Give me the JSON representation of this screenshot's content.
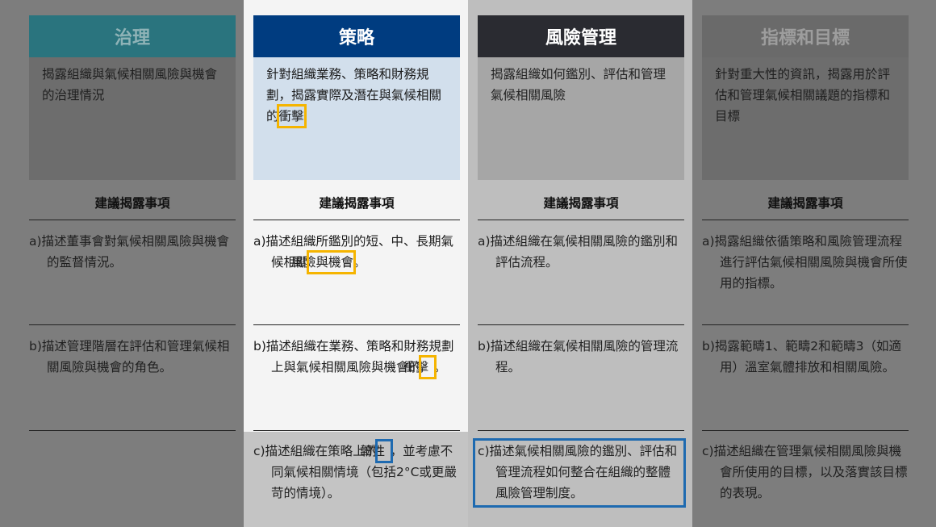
{
  "subheading": "建議揭露事項",
  "columns": [
    {
      "key": "governance",
      "title": "治理",
      "description": "揭露組織與氣候相關風險與機會的治理情況",
      "items": [
        {
          "label": "a)",
          "text": "描述董事會對氣候相關風險與機會的監督情況。"
        },
        {
          "label": "b)",
          "text": "描述管理階層在評估和管理氣候相關風險與機會的角色。"
        }
      ]
    },
    {
      "key": "strategy",
      "title": "策略",
      "description_pre": "針對組織業務、策略和財務規劃，揭露實際及潛在與氣候相關的",
      "description_hl": "衝擊",
      "items": [
        {
          "label": "a)",
          "text_pre": "描述組織所鑑別的短、中、長期氣候相關",
          "text_hl": "風險與機會",
          "text_post": "。"
        },
        {
          "label": "b)",
          "text_pre": "描述組織在業務、策略和財務規劃上與氣候相關風險與機會的",
          "text_hl": "衝擊",
          "text_post": "。"
        },
        {
          "label": "c)",
          "text_pre": "描述組織在策略上的",
          "text_hl": "韌性",
          "text_post": "，並考慮不同氣候相關情境（包括2°C或更嚴苛的情境）。"
        }
      ]
    },
    {
      "key": "risk",
      "title": "風險管理",
      "description": "揭露組織如何鑑別、評估和管理氣候相關風險",
      "items": [
        {
          "label": "a)",
          "text": "描述組織在氣候相關風險的鑑別和評估流程。"
        },
        {
          "label": "b)",
          "text": "描述組織在氣候相關風險的管理流程。"
        },
        {
          "label": "c)",
          "text": "描述氣候相關風險的鑑別、評估和管理流程如何整合在組織的整體風險管理制度。"
        }
      ]
    },
    {
      "key": "metrics",
      "title": "指標和目標",
      "description": "針對重大性的資訊，揭露用於評估和管理氣候相關議題的指標和目標",
      "items": [
        {
          "label": "a)",
          "text": "揭露組織依循策略和風險管理流程進行評估氣候相關風險與機會所使用的指標。"
        },
        {
          "label": "b)",
          "text": "揭露範疇1、範疇2和範疇3（如適用）溫室氣體排放和相關風險。"
        },
        {
          "label": "c)",
          "text": "描述組織在管理氣候相關風險與機會所使用的目標，以及落實該目標的表現。"
        }
      ]
    }
  ],
  "colors": {
    "governance_header": "#2a747e",
    "strategy_header": "#003c80",
    "risk_header": "#2a2b31",
    "metrics_header": "#6a6a6a",
    "highlight_yellow": "#f5b400",
    "highlight_blue": "#1e6ab0"
  }
}
